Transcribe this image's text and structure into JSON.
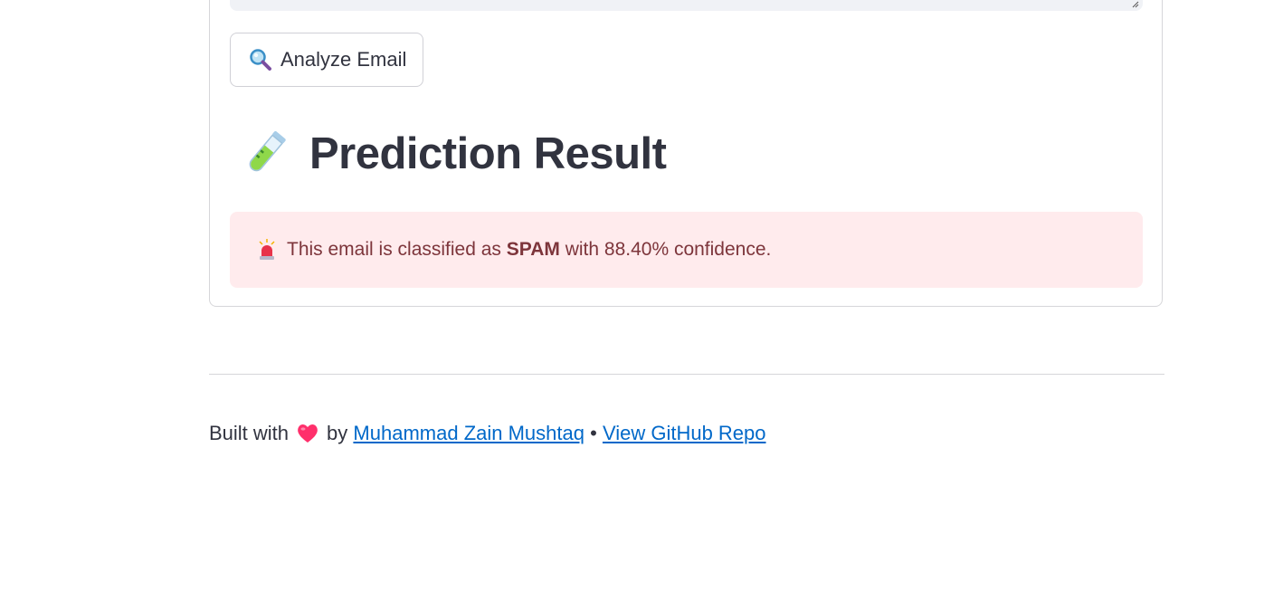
{
  "form": {
    "analyze_button_label": "Analyze Email",
    "analyze_button_icon": "magnifying-glass-icon"
  },
  "result": {
    "heading": "Prediction Result",
    "heading_icon": "test-tube-icon",
    "alert_icon": "siren-icon",
    "alert_prefix": "This email is classified as ",
    "alert_label": "SPAM",
    "alert_suffix": " with 88.40% confidence.",
    "alert_color": "#ffebed",
    "alert_text_color": "#7d353b"
  },
  "footer": {
    "built_with": "Built with",
    "heart_icon": "heart-icon",
    "by": "by",
    "author_link": "Muhammad Zain Mushtaq",
    "separator": "•",
    "repo_link": "View GitHub Repo",
    "link_color": "#0068c9"
  }
}
